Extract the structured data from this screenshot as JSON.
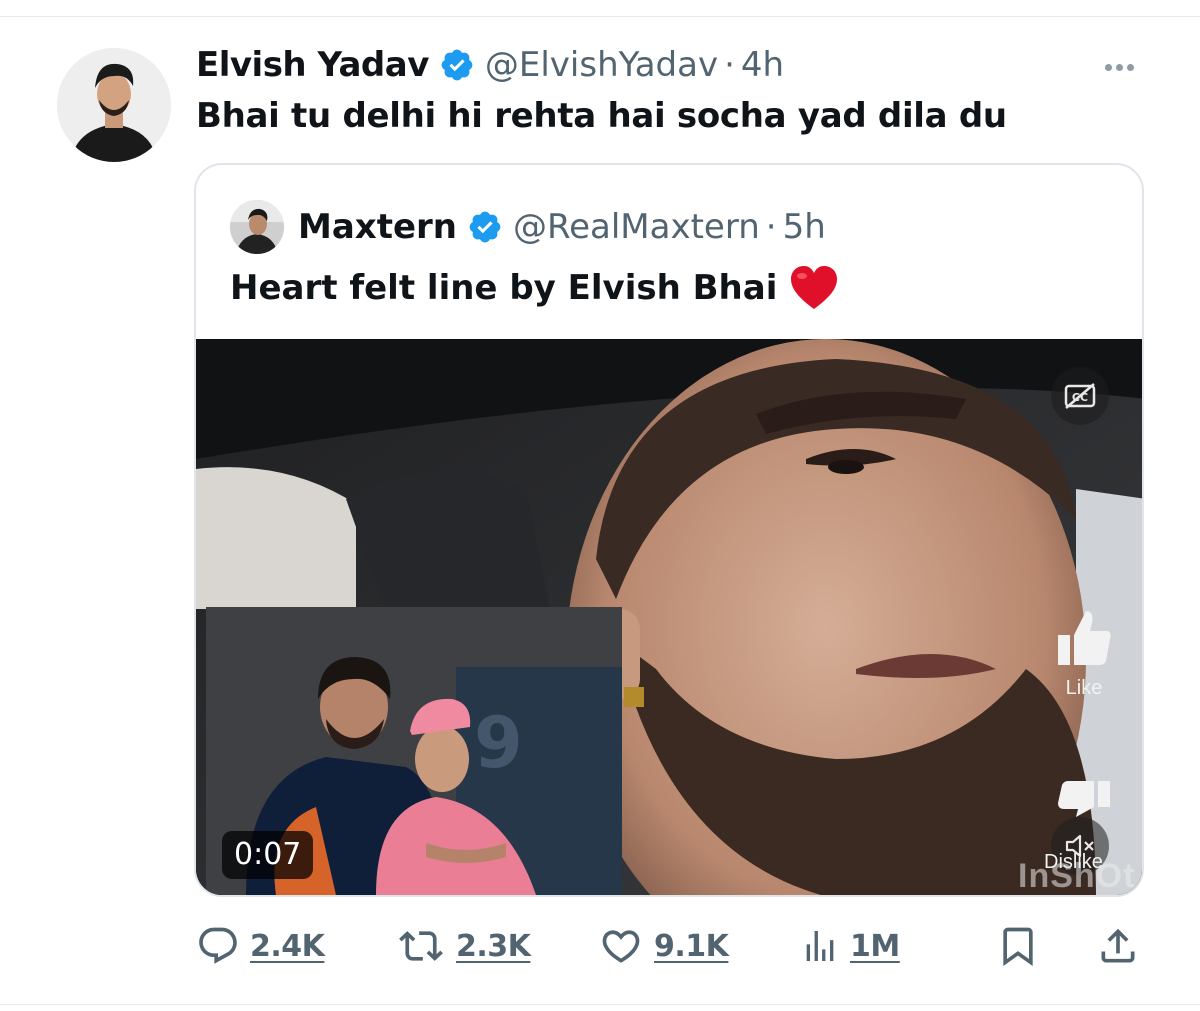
{
  "tweet": {
    "author_name": "Elvish Yadav",
    "handle": "@ElvishYadav",
    "separator": "·",
    "time": "4h",
    "text": "Bhai tu delhi hi rehta hai socha yad dila du"
  },
  "quote": {
    "author_name": "Maxtern",
    "handle": "@RealMaxtern",
    "separator": "·",
    "time": "5h",
    "text": "Heart felt line by Elvish Bhai",
    "video": {
      "duration": "0:07",
      "like_label": "Like",
      "dislike_label": "Dislike",
      "watermark": "InShOt"
    }
  },
  "actions": {
    "replies": "2.4K",
    "reposts": "2.3K",
    "likes": "9.1K",
    "views": "1M"
  },
  "colors": {
    "verified": "#1d9bf0",
    "secondary_text": "#536471",
    "primary_text": "#0f1419",
    "heart": "#e0102a"
  },
  "icons": [
    "verified-badge-icon",
    "more-icon",
    "reply-icon",
    "repost-icon",
    "like-icon",
    "views-icon",
    "bookmark-icon",
    "share-icon",
    "closed-captions-icon",
    "mute-icon",
    "thumbs-up-icon",
    "thumbs-down-icon",
    "red-heart-emoji"
  ]
}
